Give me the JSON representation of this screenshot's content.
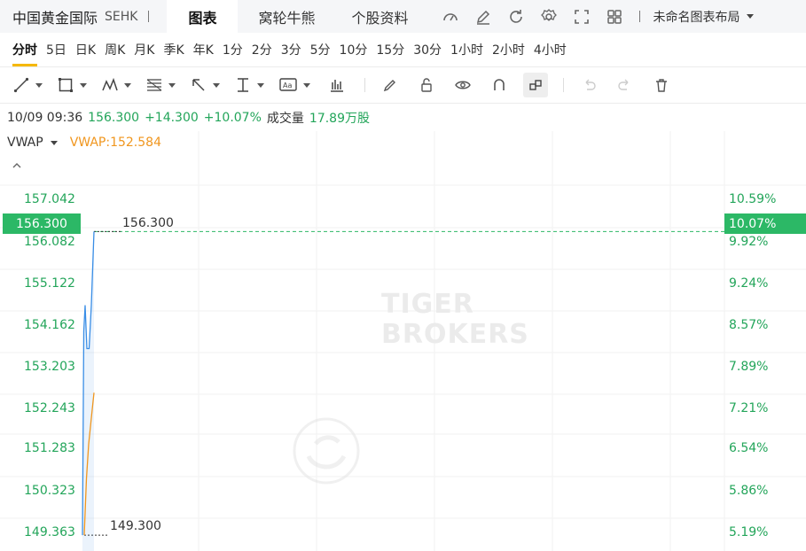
{
  "header": {
    "stock_name": "中国黄金国际",
    "exchange": "SEHK",
    "tabs": [
      "图表",
      "窝轮牛熊",
      "个股资料"
    ],
    "layout_name": "未命名图表布局"
  },
  "periods": [
    "分时",
    "5日",
    "日K",
    "周K",
    "月K",
    "季K",
    "年K",
    "1分",
    "2分",
    "3分",
    "5分",
    "10分",
    "15分",
    "30分",
    "1小时",
    "2小时",
    "4小时"
  ],
  "info": {
    "datetime": "10/09 09:36",
    "price": "156.300",
    "change": "+14.300",
    "change_pct": "+10.07%",
    "volume_label": "成交量",
    "volume": "17.89万股"
  },
  "indicator": {
    "name": "VWAP",
    "value_label": "VWAP:152.584"
  },
  "axes": {
    "left": [
      "157.042",
      "156.082",
      "155.122",
      "154.162",
      "153.203",
      "152.243",
      "151.283",
      "150.323",
      "149.363"
    ],
    "right": [
      "10.59%",
      "9.92%",
      "9.24%",
      "8.57%",
      "7.89%",
      "7.21%",
      "6.54%",
      "5.86%",
      "5.19%"
    ],
    "current_price_tag": "156.300",
    "current_pct_tag": "10.07%"
  },
  "annotations": {
    "high": "156.300",
    "low": "149.300"
  },
  "watermark": {
    "line1": "TIGER",
    "line2": "BROKERS"
  },
  "colors": {
    "up_green": "#23a55a",
    "tag_green": "#2cb866",
    "price_line": "#3a8ee6",
    "vwap_line": "#f0961e",
    "period_underline": "#f5b800"
  },
  "chart_data": {
    "type": "line",
    "x_unit": "minutes since open",
    "series": [
      {
        "name": "price",
        "values": [
          [
            0,
            149.3
          ],
          [
            0.3,
            154.0
          ],
          [
            0.6,
            154.6
          ],
          [
            1.0,
            153.6
          ],
          [
            1.5,
            153.6
          ],
          [
            2.0,
            154.6
          ],
          [
            2.6,
            156.3
          ]
        ]
      },
      {
        "name": "VWAP",
        "values": [
          [
            0.4,
            149.3
          ],
          [
            0.9,
            150.6
          ],
          [
            1.4,
            151.4
          ],
          [
            2.0,
            152.0
          ],
          [
            2.6,
            152.584
          ]
        ]
      }
    ],
    "ylim": [
      149.1,
      157.5
    ]
  }
}
